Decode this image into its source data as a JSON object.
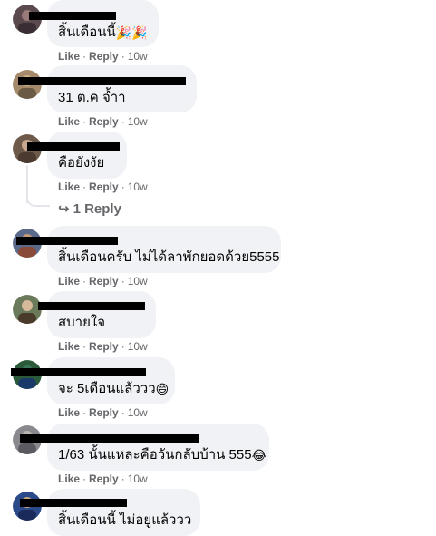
{
  "actions": {
    "like": "Like",
    "reply": "Reply",
    "separator": "·"
  },
  "comments": [
    {
      "text": "สิ้นเดือนนี้",
      "emoji": "🎉🎉",
      "time": "10w"
    },
    {
      "text": "31 ต.ค จ้ำา",
      "emoji": "",
      "time": "10w"
    },
    {
      "text": "คือยังงัย",
      "emoji": "",
      "time": "10w"
    },
    {
      "text": "สิ้นเดือนครับ ไม่ได้ลาพักยอดด้วย5555",
      "emoji": "",
      "time": "10w"
    },
    {
      "text": "สบายใจ",
      "emoji": "",
      "time": "10w"
    },
    {
      "text": "จะ 5เดือนแล้ววว",
      "emoji": "😄",
      "time": "10w"
    },
    {
      "text": "1/63 นั้นแหละคือวันกลับบ้าน 555",
      "emoji": "😂",
      "time": "10w"
    },
    {
      "text": "สิ้นเดือนนี้ ไม่อยู่แล้ววว",
      "emoji": "",
      "time": ""
    }
  ],
  "replies_link": {
    "arrow": "↪",
    "label": "1 Reply"
  },
  "colors": {
    "bubble": "#f0f2f5",
    "meta": "#65676b",
    "text": "#050505",
    "redaction": "#000000"
  }
}
